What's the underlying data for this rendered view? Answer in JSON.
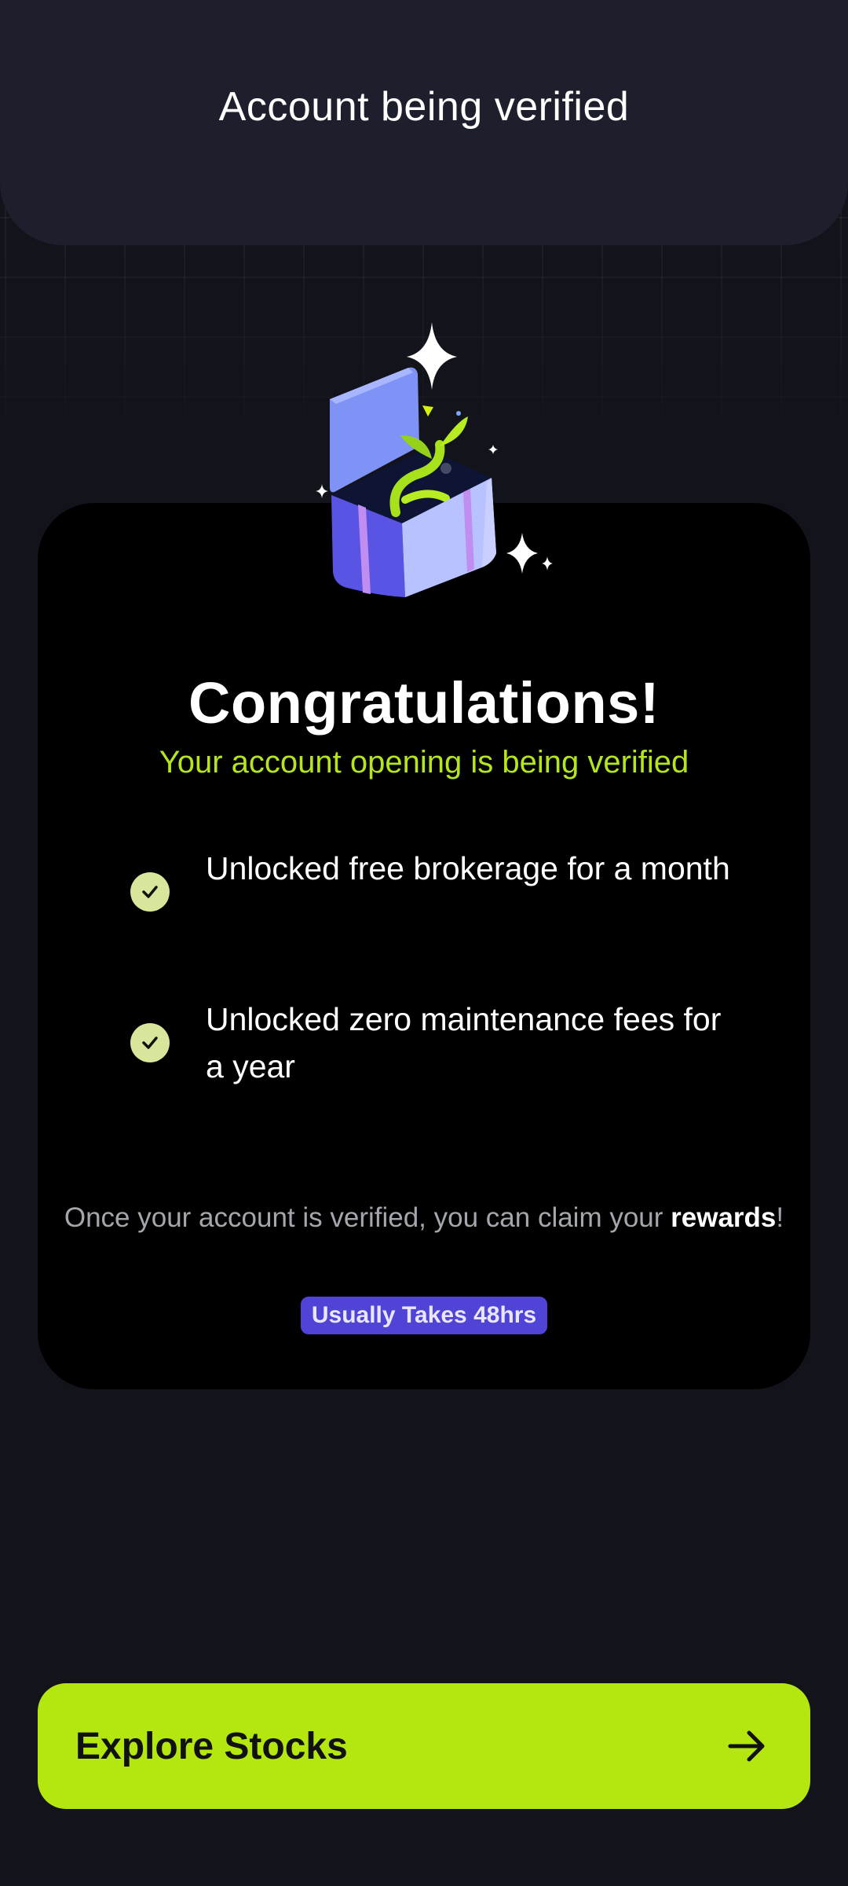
{
  "header": {
    "title": "Account being verified"
  },
  "hero": {
    "title": "Congratulations!",
    "subtitle": "Your account opening is being verified"
  },
  "benefits": [
    {
      "text": "Unlocked free brokerage for a month",
      "icon": "check-circle-icon"
    },
    {
      "text": "Unlocked zero maintenance fees for a year",
      "icon": "check-circle-icon"
    }
  ],
  "claim": {
    "prefix": "Once your account is verified, you can claim your ",
    "highlight": "rewards",
    "suffix": "!"
  },
  "badge": {
    "label": "Usually Takes 48hrs"
  },
  "cta": {
    "label": "Explore Stocks",
    "icon": "arrow-right-icon"
  },
  "colors": {
    "background": "#13141b",
    "header": "#1d1f2c",
    "card": "#000000",
    "accent": "#b4e60f",
    "check": "#d7e69a",
    "badge": "#5044d6"
  }
}
